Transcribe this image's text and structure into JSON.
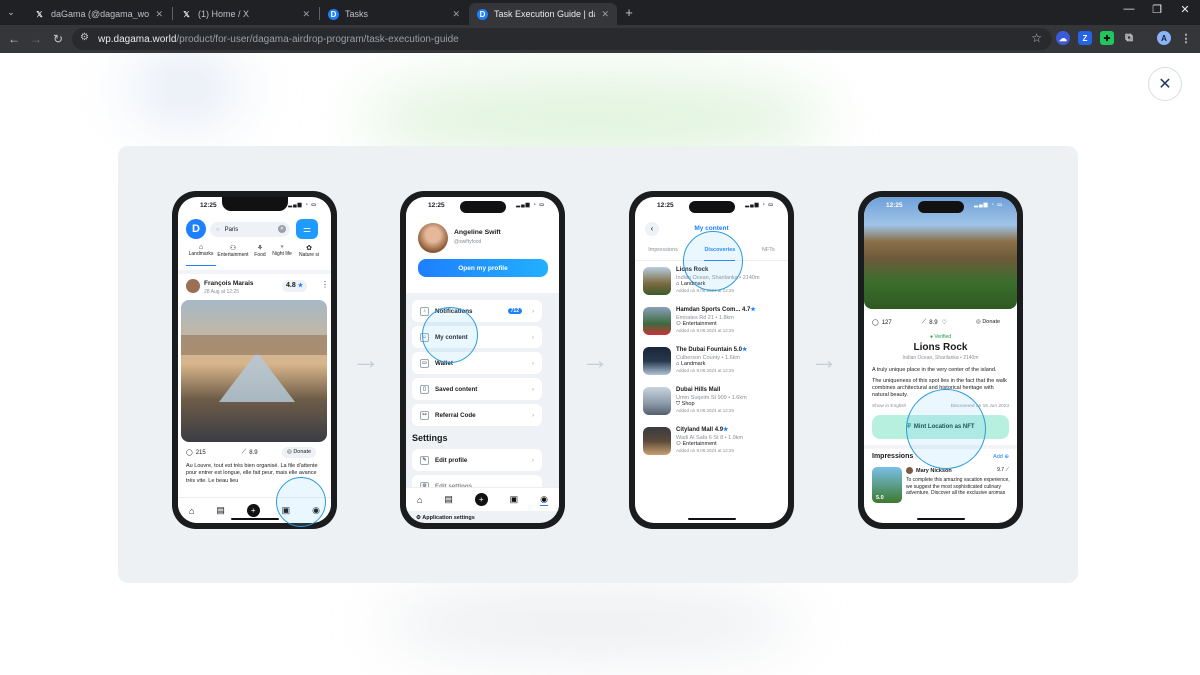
{
  "browser": {
    "tabs": [
      {
        "icon": "x-logo-icon",
        "title": "daGama (@dagama_world) / X",
        "active": false
      },
      {
        "icon": "x-logo-icon",
        "title": "(1) Home / X",
        "active": false
      },
      {
        "icon": "dagama-icon",
        "title": "Tasks",
        "active": false
      },
      {
        "icon": "dagama-icon",
        "title": "Task Execution Guide | daGama",
        "active": true
      }
    ],
    "url_host": "wp.dagama.world",
    "url_path": "/product/for-user/dagama-airdrop-program/task-execution-guide",
    "profile_initial": "A"
  },
  "colors": {
    "accent": "#1e7fff",
    "panel_bg": "#eef1f4",
    "highlight": "#2a9be0",
    "mint_btn": "#b8f0e0"
  },
  "phone1": {
    "time": "12:25",
    "search": "Paris",
    "categories": [
      "Landmarks",
      "Entertainment",
      "Food",
      "Night life",
      "Nature si"
    ],
    "user": "François Marais",
    "date": "28 Aug at 12:25",
    "rating": "4.8",
    "comments": "215",
    "score": "8.9",
    "donate": "Donate",
    "caption": "Au Louvre, tout est très bien organisé. La file d'attente pour entrer est longue, elle fait peur, mais elle avance très vite. Le beau lieu"
  },
  "phone2": {
    "time": "12:25",
    "name": "Angeline Swift",
    "handle": "@swiftyfood",
    "open_profile": "Open my profile",
    "menu": [
      {
        "icon": "bell-icon",
        "label": "Notifications",
        "badge": "712"
      },
      {
        "icon": "user-icon",
        "label": "My content",
        "badge": ""
      },
      {
        "icon": "wallet-icon",
        "label": "Wallet",
        "badge": ""
      },
      {
        "icon": "bookmark-icon",
        "label": "Saved content",
        "badge": ""
      },
      {
        "icon": "referral-icon",
        "label": "Referral Code",
        "badge": ""
      }
    ],
    "settings_title": "Settings",
    "settings": [
      "Edit profile",
      "Edit settings",
      "Application settings"
    ]
  },
  "phone3": {
    "time": "12:25",
    "title": "My content",
    "tabs": [
      "Impressions",
      "Discoveries",
      "NFTs"
    ],
    "items": [
      {
        "name": "Lions Rock",
        "rating": "",
        "loc": "Indian Ocean, Sharilanka • 2140m",
        "cat": "Landmark",
        "added": "Added on 8.08.2024 at 12:25",
        "color": "#7a6a3e"
      },
      {
        "name": "Hamdan Sports Com...",
        "rating": "4.7",
        "loc": "Emirates Rd 21 • 1.8km",
        "cat": "Entertainment",
        "added": "Added on 8.08.2024 at 12:25",
        "color": "#3d6b3f"
      },
      {
        "name": "The Dubai Fountain",
        "rating": "5.0",
        "loc": "Culberson County • 1.6km",
        "cat": "Landmark",
        "added": "Added on 8.08.2024 at 12:25",
        "color": "#26384f"
      },
      {
        "name": "Dubai Hills Mall",
        "rating": "",
        "loc": "Umm Suqeim St 909 • 1.6km",
        "cat": "Shop",
        "added": "Added on 8.08.2024 at 12:25",
        "color": "#8a98a8"
      },
      {
        "name": "Cityland Mall",
        "rating": "4.9",
        "loc": "Wadi Al Safa 6 St 8 • 1.9km",
        "cat": "Entertainment",
        "added": "Added on 8.08.2024 at 12:25",
        "color": "#5a4a3a"
      }
    ]
  },
  "phone4": {
    "time": "12:25",
    "comments": "127",
    "score": "8.9",
    "donate": "Donate",
    "verified": "Verified",
    "title": "Lions Rock",
    "location": "Indian Ocean, Sharilanka • 2140m",
    "desc1": "A truly unique place in the very center of the island.",
    "desc2": "The uniqueness of this spot lies in the fact that the walk combines architectural and historical heritage with natural beauty.",
    "show_in": "Show in English",
    "discovered": "Discovered on 18 Jun 2023",
    "mint": "Mint Location as NFT",
    "impressions": "Impressions",
    "add": "Add",
    "reviewer": "Mary Nickson",
    "review_score": "9.7",
    "review_rating": "5.0",
    "review": "To complete this amazing vacation experience, we suggest the most sophisticated culinary adventure. Discover all the exclusive aromas"
  }
}
